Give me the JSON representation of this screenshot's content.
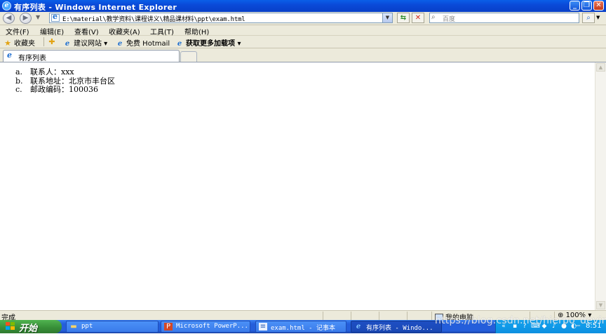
{
  "window": {
    "title": "有序列表 - Windows Internet Explorer",
    "controls": {
      "minimize": "_",
      "maximize": "❐",
      "close": "✕"
    }
  },
  "navigation": {
    "address": "E:\\material\\教学资料\\课程讲义\\精品课材料\\ppt\\exam.html",
    "search_placeholder": "百度"
  },
  "menu": {
    "items": [
      "文件(F)",
      "编辑(E)",
      "查看(V)",
      "收藏夹(A)",
      "工具(T)",
      "帮助(H)"
    ]
  },
  "favorites_bar": {
    "favorites_label": "收藏夹",
    "items": [
      "建议网站 ▾",
      "免费 Hotmail",
      "获取更多加载项 ▾"
    ]
  },
  "tabs": [
    {
      "label": "有序列表"
    }
  ],
  "content": {
    "list": [
      {
        "marker": "a.",
        "text": "联系人：xxx"
      },
      {
        "marker": "b.",
        "text": "联系地址：北京市丰台区"
      },
      {
        "marker": "c.",
        "text": "邮政编码：100036"
      }
    ]
  },
  "status": {
    "text": "完成",
    "zone": "我的电脑",
    "zoom": "100%"
  },
  "taskbar": {
    "start_label": "开始",
    "tasks": [
      {
        "label": "ppt",
        "icon": "folder-icon"
      },
      {
        "label": "Microsoft PowerP...",
        "icon": "powerpoint-icon"
      },
      {
        "label": "exam.html - 记事本",
        "icon": "notepad-icon"
      },
      {
        "label": "有序列表 - Windo...",
        "icon": "ie-icon"
      }
    ],
    "clock": "8:51"
  },
  "watermark": "https://blog.csdn.net/hierpo_devin",
  "colors": {
    "title_bar": "#0a4ad8",
    "taskbar": "#245edb",
    "start_button": "#378d37",
    "tray": "#0c8fe0"
  }
}
